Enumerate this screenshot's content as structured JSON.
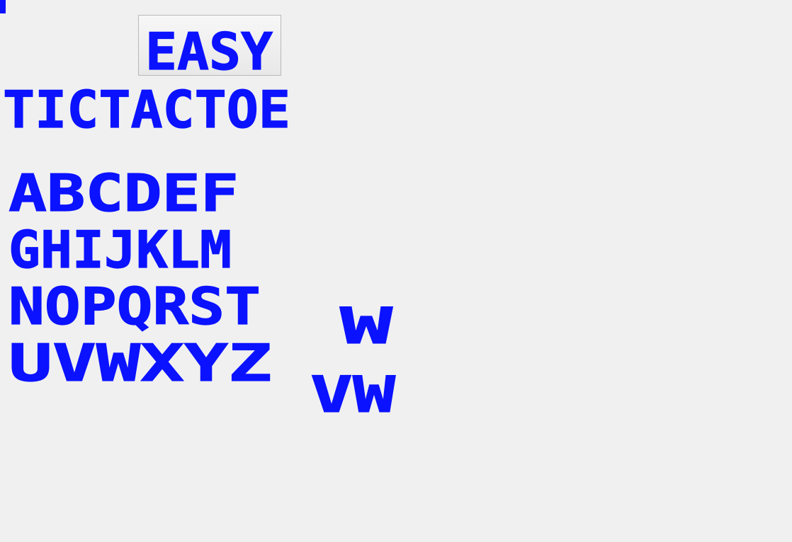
{
  "difficulty_button": {
    "label": "EASY"
  },
  "title": "TICTACTOE",
  "alphabet": {
    "rows": [
      "ABCDEF",
      "GHIJKLM",
      "NOPQRST",
      "UVWXYZ"
    ]
  },
  "sample_glyphs": {
    "single": "W",
    "pair": "VW"
  },
  "colors": {
    "glyph": "#0b12ff",
    "background": "#f0f0f0",
    "button_border": "#b8b8b8"
  }
}
